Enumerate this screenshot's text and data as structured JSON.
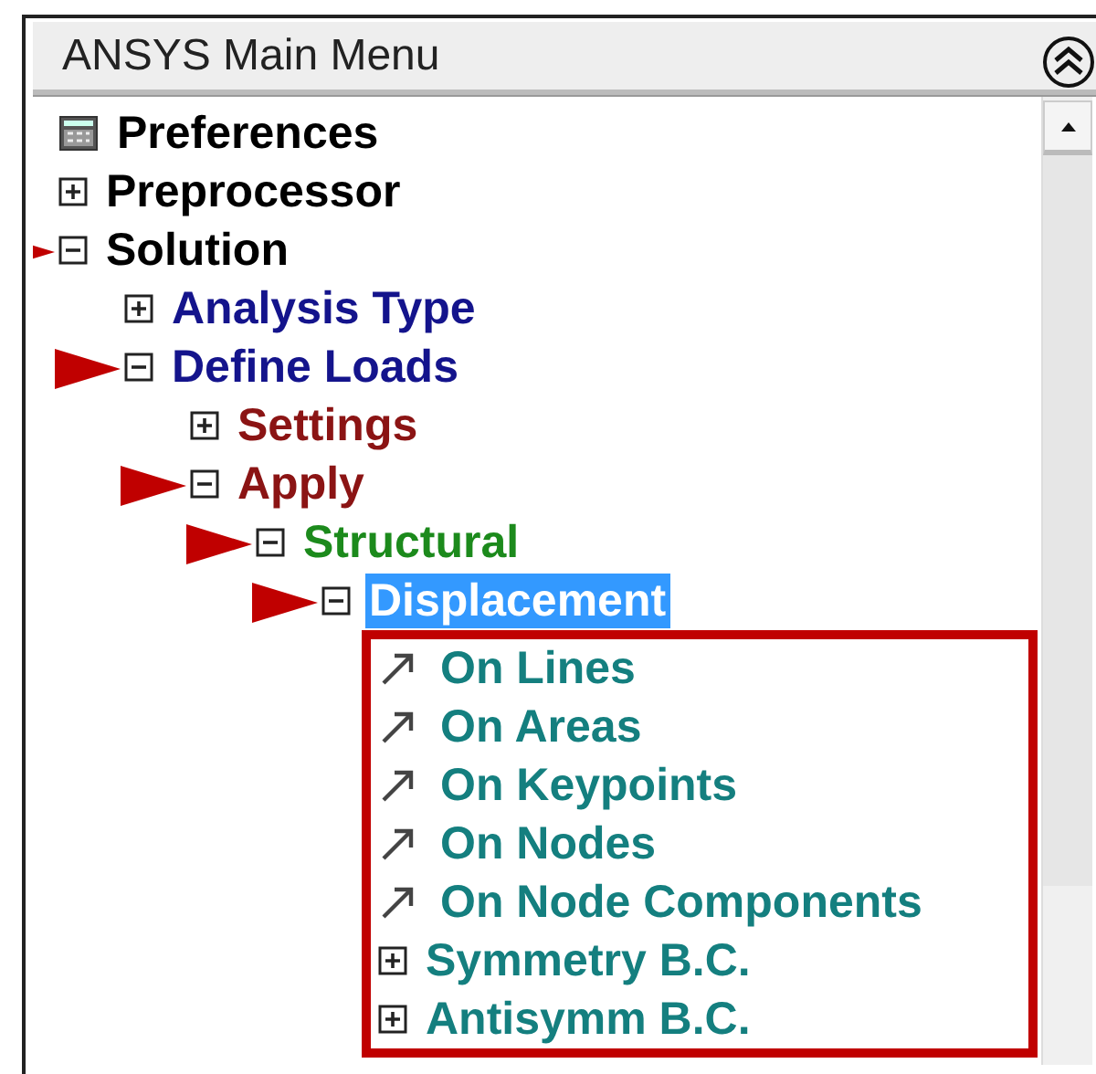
{
  "panel": {
    "title": "ANSYS Main Menu"
  },
  "tree": [
    {
      "label": "Preferences",
      "kind": "settings",
      "color": "#000000",
      "selected": false,
      "pointer": false
    },
    {
      "label": "Preprocessor",
      "kind": "folder",
      "expanded": false,
      "color": "#000000",
      "selected": false,
      "pointer": false
    },
    {
      "label": "Solution",
      "kind": "folder",
      "expanded": true,
      "color": "#000000",
      "selected": false,
      "pointer": true,
      "children": [
        {
          "label": "Analysis Type",
          "kind": "folder",
          "expanded": false,
          "color": "#14148c",
          "selected": false,
          "pointer": false
        },
        {
          "label": "Define Loads",
          "kind": "folder",
          "expanded": true,
          "color": "#14148c",
          "selected": false,
          "pointer": true,
          "children": [
            {
              "label": "Settings",
              "kind": "folder",
              "expanded": false,
              "color": "#8b1414",
              "selected": false,
              "pointer": false
            },
            {
              "label": "Apply",
              "kind": "folder",
              "expanded": true,
              "color": "#8b1414",
              "selected": false,
              "pointer": true,
              "children": [
                {
                  "label": "Structural",
                  "kind": "folder",
                  "expanded": true,
                  "color": "#1c8a1c",
                  "selected": false,
                  "pointer": true,
                  "children": [
                    {
                      "label": "Displacement",
                      "kind": "folder",
                      "expanded": true,
                      "selected": true,
                      "pointer": true,
                      "boxed_children": true,
                      "children": [
                        {
                          "label": "On Lines",
                          "kind": "command",
                          "color": "#147f7f",
                          "selected": false,
                          "pointer": false
                        },
                        {
                          "label": "On Areas",
                          "kind": "command",
                          "color": "#147f7f",
                          "selected": false,
                          "pointer": false
                        },
                        {
                          "label": "On Keypoints",
                          "kind": "command",
                          "color": "#147f7f",
                          "selected": false,
                          "pointer": false
                        },
                        {
                          "label": "On Nodes",
                          "kind": "command",
                          "color": "#147f7f",
                          "selected": false,
                          "pointer": false
                        },
                        {
                          "label": "On Node Components",
                          "kind": "command",
                          "color": "#147f7f",
                          "selected": false,
                          "pointer": false
                        },
                        {
                          "label": "Symmetry B.C.",
                          "kind": "folder",
                          "expanded": false,
                          "color": "#147f7f",
                          "selected": false,
                          "pointer": false
                        },
                        {
                          "label": "Antisymm B.C.",
                          "kind": "folder",
                          "expanded": false,
                          "color": "#147f7f",
                          "selected": false,
                          "pointer": false
                        }
                      ]
                    }
                  ]
                }
              ]
            }
          ]
        }
      ]
    }
  ]
}
